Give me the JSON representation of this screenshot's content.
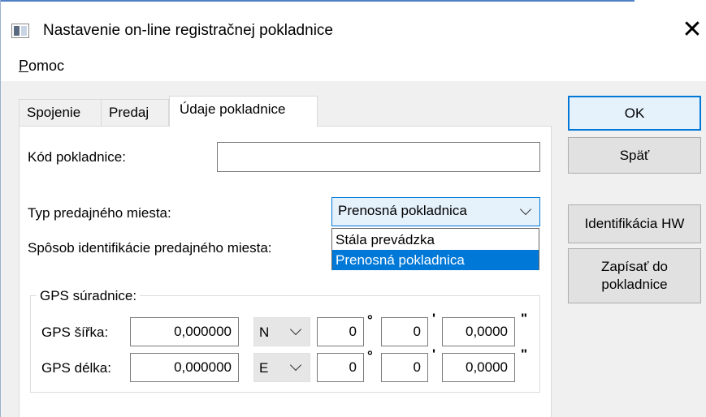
{
  "window": {
    "title": "Nastavenie on-line registračnej pokladnice"
  },
  "menu": {
    "pomoc_first": "P",
    "pomoc_rest": "omoc"
  },
  "tabs": [
    {
      "label": "Spojenie"
    },
    {
      "label": "Predaj"
    },
    {
      "label": "Údaje pokladnice"
    }
  ],
  "form": {
    "kod_label": "Kód pokladnice:",
    "kod_value": "",
    "typ_label": "Typ predajného miesta:",
    "typ_value": "Prenosná pokladnica",
    "sposob_label": "Spôsob identifikácie predajného miesta:",
    "dropdown_options": [
      "Stála prevádzka",
      "Prenosná pokladnica"
    ]
  },
  "gps": {
    "group_title": "GPS súradnice:",
    "sirka": {
      "label": "GPS šířka:",
      "value": "0,000000",
      "dir": "N",
      "deg": "0",
      "min": "0",
      "sec": "0,0000"
    },
    "delka": {
      "label": "GPS délka:",
      "value": "0,000000",
      "dir": "E",
      "deg": "0",
      "min": "0",
      "sec": "0,0000"
    },
    "deg_symbol": "°",
    "min_symbol": "'",
    "sec_symbol": "\""
  },
  "buttons": {
    "ok": "OK",
    "spat": "Späť",
    "ident_hw": "Identifikácia HW",
    "zapisat_line1": "Zapísať do",
    "zapisat_line2": "pokladnice"
  },
  "colors": {
    "accent": "#0078d7",
    "dialog_bg": "#f0f0f0"
  }
}
